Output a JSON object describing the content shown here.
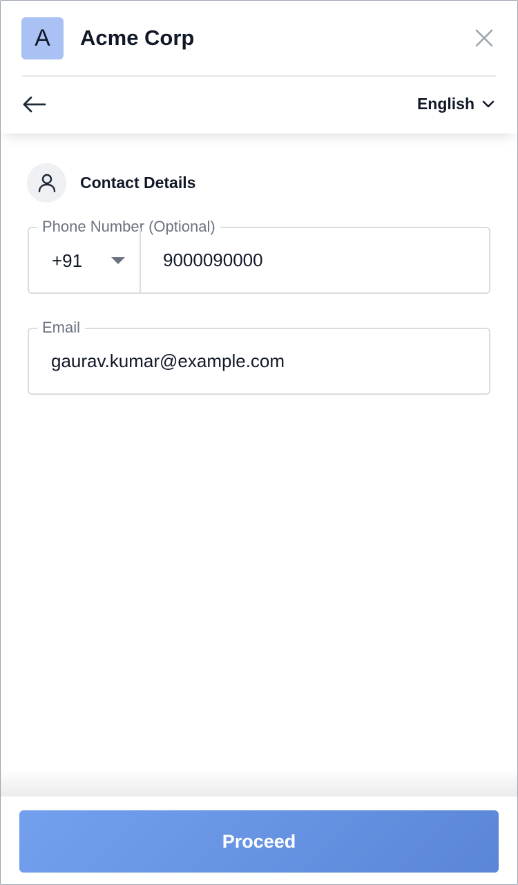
{
  "header": {
    "logo_letter": "A",
    "merchant_name": "Acme Corp",
    "language_label": "English"
  },
  "section": {
    "title": "Contact Details"
  },
  "phone": {
    "legend": "Phone Number (Optional)",
    "country_code": "+91",
    "value": "9000090000"
  },
  "email": {
    "legend": "Email",
    "value": "gaurav.kumar@example.com"
  },
  "footer": {
    "proceed_label": "Proceed"
  },
  "colors": {
    "accent": "#6b94e2",
    "logo_bg": "#a9c1f3"
  },
  "icons": {
    "close": "close-icon",
    "back": "arrow-left-icon",
    "language": "chevron-down-icon",
    "user": "user-icon",
    "country_code": "caret-down-icon"
  }
}
